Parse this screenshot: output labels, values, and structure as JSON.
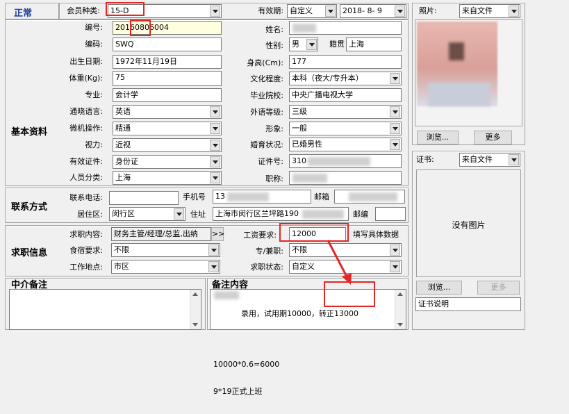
{
  "status": "正常",
  "member": {
    "type_label": "会员种类:",
    "type_value": "15-D"
  },
  "validity": {
    "label": "有效期:",
    "mode": "自定义",
    "date": "2018- 8- 9"
  },
  "photo": {
    "label": "照片:",
    "source": "来自文件",
    "browse": "浏览...",
    "more": "更多"
  },
  "cert": {
    "label": "证书:",
    "source": "来自文件",
    "empty_text": "没有图片",
    "browse": "浏览...",
    "more": "更多",
    "note_value": "证书说明"
  },
  "basic": {
    "title": "基本资料",
    "id_label": "编号:",
    "id_value": "20160806004",
    "name_label": "姓名:",
    "code_label": "编码:",
    "code_value": "SWQ",
    "gender_label": "性别:",
    "gender_value": "男",
    "origin_label": "籍贯",
    "origin_value": "上海",
    "birth_label": "出生日期:",
    "birth_value": "1972年11月19日",
    "height_label": "身高(Cm):",
    "height_value": "177",
    "weight_label": "体重(Kg):",
    "weight_value": "75",
    "edu_label": "文化程度:",
    "edu_value": "本科（夜大/专升本）",
    "major_label": "专业:",
    "major_value": "会计学",
    "school_label": "毕业院校:",
    "school_value": "中央广播电视大学",
    "lang_label": "通晓语言:",
    "lang_value": "英语",
    "lang_level_label": "外语等级:",
    "lang_level_value": "三级",
    "pc_label": "微机操作:",
    "pc_value": "精通",
    "image_label": "形象:",
    "image_value": "一般",
    "vision_label": "视力:",
    "vision_value": "近视",
    "marital_label": "婚育状况:",
    "marital_value": "已婚男性",
    "idtype_label": "有效证件:",
    "idtype_value": "身份证",
    "idno_label": "证件号:",
    "idno_value": "310",
    "category_label": "人员分类:",
    "category_value": "上海",
    "title_label": "职称:"
  },
  "contact": {
    "title": "联系方式",
    "phone_label": "联系电话:",
    "mobile_label": "手机号",
    "mobile_value": "13",
    "email_label": "邮箱",
    "district_label": "居住区:",
    "district_value": "闵行区",
    "address_label": "住址",
    "address_value": "上海市闵行区兰坪路190",
    "zip_label": "邮编"
  },
  "job": {
    "title": "求职信息",
    "content_label": "求职内容:",
    "content_value": "财务主管/经理/总监,出纳",
    "more_btn": ">>",
    "salary_label": "工资要求:",
    "salary_value": "12000",
    "salary_hint": "填写具体数据",
    "lodging_label": "食宿要求:",
    "lodging_value": "不限",
    "parttime_label": "专/兼职:",
    "parttime_value": "不限",
    "location_label": "工作地点:",
    "location_value": "市区",
    "status_label": "求职状态:",
    "status_value": "自定义"
  },
  "agency_note": {
    "title": "中介备注"
  },
  "remark": {
    "title": "备注内容",
    "line1": "录用，试用期10000，转正13000",
    "line2": "10000*0.6=6000",
    "line3": "9*19正式上班"
  }
}
